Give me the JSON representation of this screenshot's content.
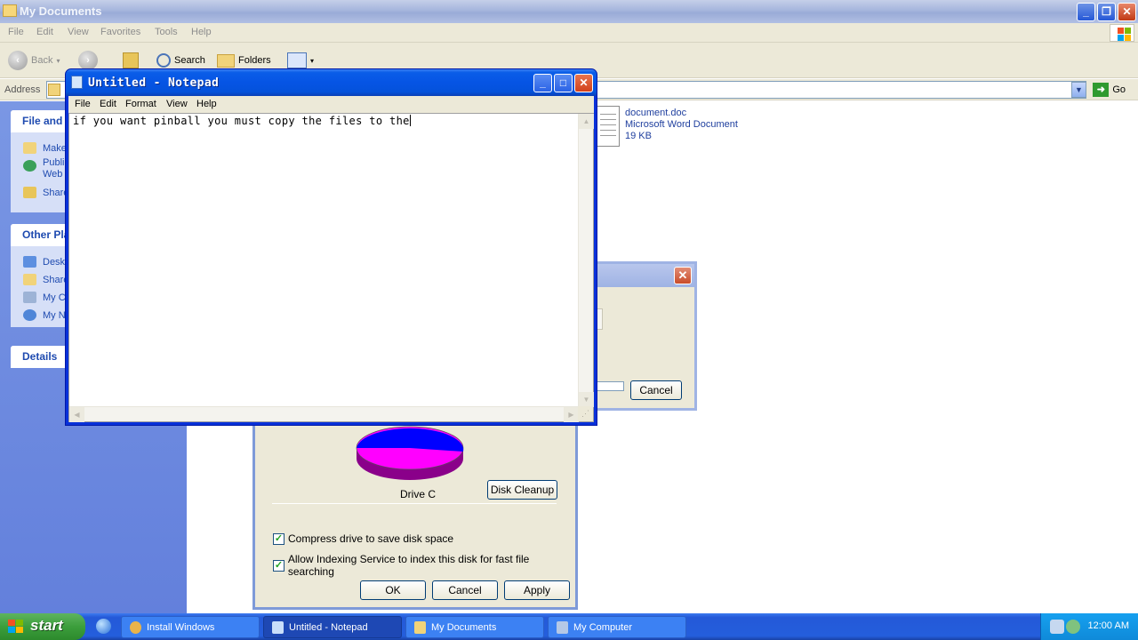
{
  "explorer": {
    "title": "My Documents",
    "menu": [
      "File",
      "Edit",
      "View",
      "Favorites",
      "Tools",
      "Help"
    ],
    "toolbar": {
      "back": "Back",
      "search": "Search",
      "folders": "Folders"
    },
    "address": {
      "label": "Address",
      "go": "Go"
    },
    "tasks": {
      "file_section": "File and",
      "file_items": [
        "Make",
        "Publi",
        "Web",
        "Share"
      ],
      "other_section": "Other Pla",
      "other_items": [
        "Deskt",
        "Share",
        "My C",
        "My N"
      ],
      "details": "Details"
    },
    "file": {
      "name": "document.doc",
      "type": "Microsoft Word Document",
      "size": "19 KB"
    }
  },
  "notepad": {
    "title": "Untitled - Notepad",
    "menu": [
      "File",
      "Edit",
      "Format",
      "View",
      "Help"
    ],
    "content": "if you want pinball you must copy the files to the"
  },
  "small_dialog": {
    "cancel": "Cancel"
  },
  "drive_properties": {
    "drive_label": "Drive C",
    "disk_cleanup": "Disk Cleanup",
    "compress": "Compress drive to save disk space",
    "indexing": "Allow Indexing Service to index this disk for fast file searching",
    "ok": "OK",
    "cancel": "Cancel",
    "apply": "Apply",
    "pie": {
      "used_color": "#ff00ff",
      "free_color": "#0000ff"
    }
  },
  "taskbar": {
    "start": "start",
    "tasks": [
      "Install Windows",
      "Untitled - Notepad",
      "My Documents",
      "My Computer"
    ],
    "active_task": "Untitled - Notepad",
    "clock": "12:00 AM"
  },
  "colors": {
    "accent_blue": "#0654e4",
    "start_green": "#3c9e3c",
    "taskbar_blue": "#245edc"
  }
}
